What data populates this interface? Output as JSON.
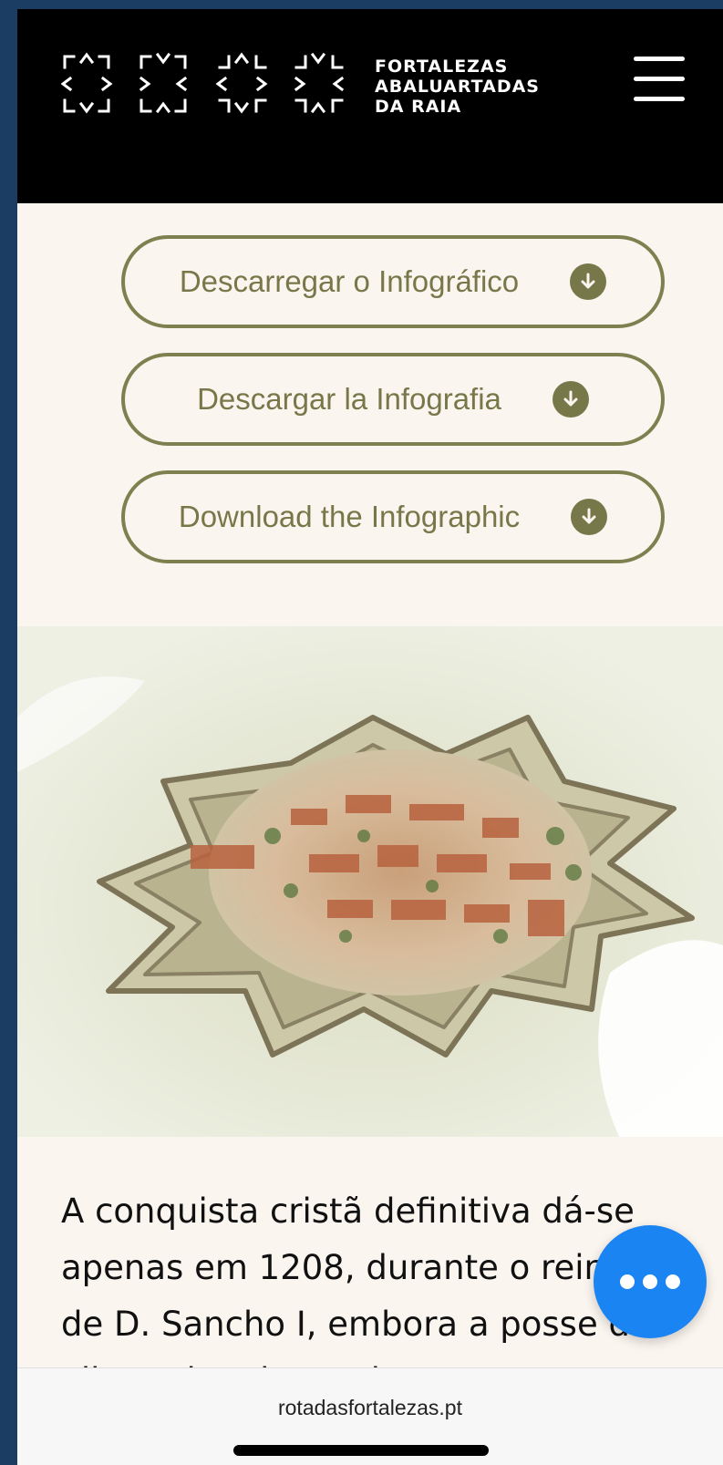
{
  "header": {
    "logo_lines": [
      "FORTALEZAS",
      "ABALUARTADAS",
      "DA RAIA"
    ],
    "menu_icon": "hamburger-menu-icon",
    "background": "#000000"
  },
  "downloads": [
    {
      "label": "Descarregar o Infográfico",
      "icon": "download-arrow-icon"
    },
    {
      "label": "Descargar la Infografia",
      "icon": "download-arrow-icon"
    },
    {
      "label": "Download the Infographic",
      "icon": "download-arrow-icon"
    }
  ],
  "article": {
    "text": "A conquista cristã definitiva dá-se apenas em 1208, durante o reinado de D. Sancho I, embora a posse da vila tenha alternado entre mouros"
  },
  "fab": {
    "icon": "more-dots-icon",
    "color": "#1b84f3"
  },
  "browser": {
    "url": "rotadasfortalezas.pt"
  },
  "colors": {
    "accent": "#77784a",
    "page_bg": "#fbf5ef",
    "frame": "#1b3d63"
  }
}
